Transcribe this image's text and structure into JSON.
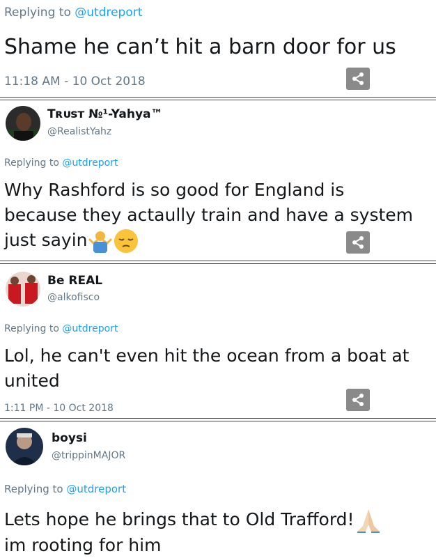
{
  "tweets": [
    {
      "replying_prefix": "Replying to",
      "replying_handle": "@utdreport",
      "text": "Shame he can’t hit a barn door for us",
      "timestamp": "11:18 AM - 10 Oct 2018"
    },
    {
      "name": "Tʀᴜsᴛ №¹-Yahya™",
      "handle": "@RealistYahz",
      "replying_prefix": "Replying to",
      "replying_handle": "@utdreport",
      "text_line1": "Why Rashford is so good for England is",
      "text_line2": "because they actaully train and have a system",
      "text_line3": "just sayin"
    },
    {
      "name": "Be REAL",
      "handle": "@alkofisco",
      "replying_prefix": "Replying to",
      "replying_handle": "@utdreport",
      "text_line1": "Lol, he can't even hit the ocean from a boat at",
      "text_line2": "united",
      "timestamp": "1:11 PM - 10 Oct 2018"
    },
    {
      "name": "boysi",
      "handle": "@trippinMAJOR",
      "replying_prefix": "Replying to",
      "replying_handle": "@utdreport",
      "text_line1": "Lets hope he brings that to Old Trafford!",
      "text_line2": "im rooting for him"
    }
  ],
  "icons": {
    "share": "share-icon",
    "man_shrugging": "man-shrugging-emoji",
    "pensive": "pensive-face-emoji",
    "folded_hands": "folded-hands-emoji"
  },
  "colors": {
    "link": "#1da1f2",
    "muted": "#657786",
    "share_bg": "#8a8a8a"
  }
}
